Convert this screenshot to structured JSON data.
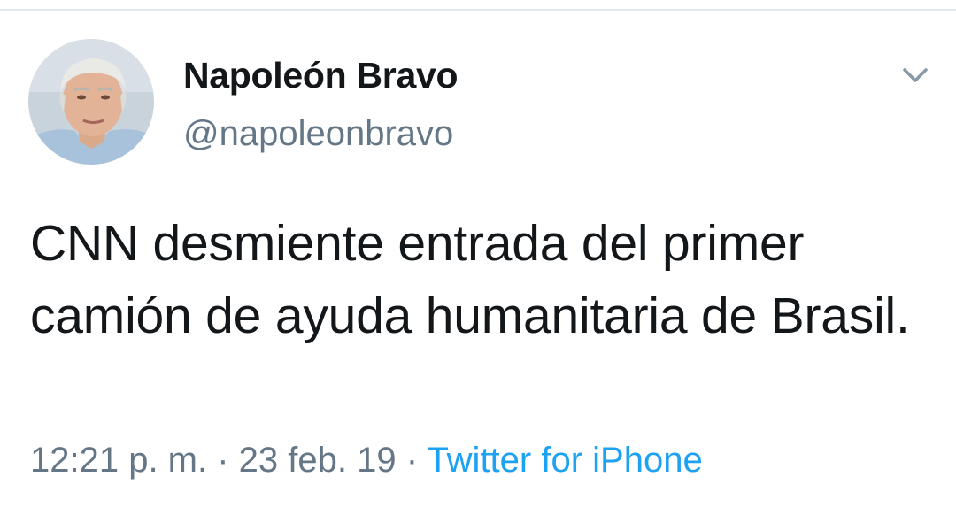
{
  "tweet": {
    "author": {
      "display_name": "Napoleón Bravo",
      "handle": "@napoleonbravo"
    },
    "text": "CNN desmiente entrada del primer camión de ayuda humanitaria de Brasil.",
    "time": "12:21 p. m.",
    "separator": " · ",
    "date": "23 feb. 19",
    "source": "Twitter for iPhone"
  },
  "icons": {
    "menu_caret": "chevron-down-icon"
  },
  "colors": {
    "text_primary": "#14171a",
    "text_secondary": "#657786",
    "link": "#1da1f2",
    "divider": "#e1e8ed"
  }
}
